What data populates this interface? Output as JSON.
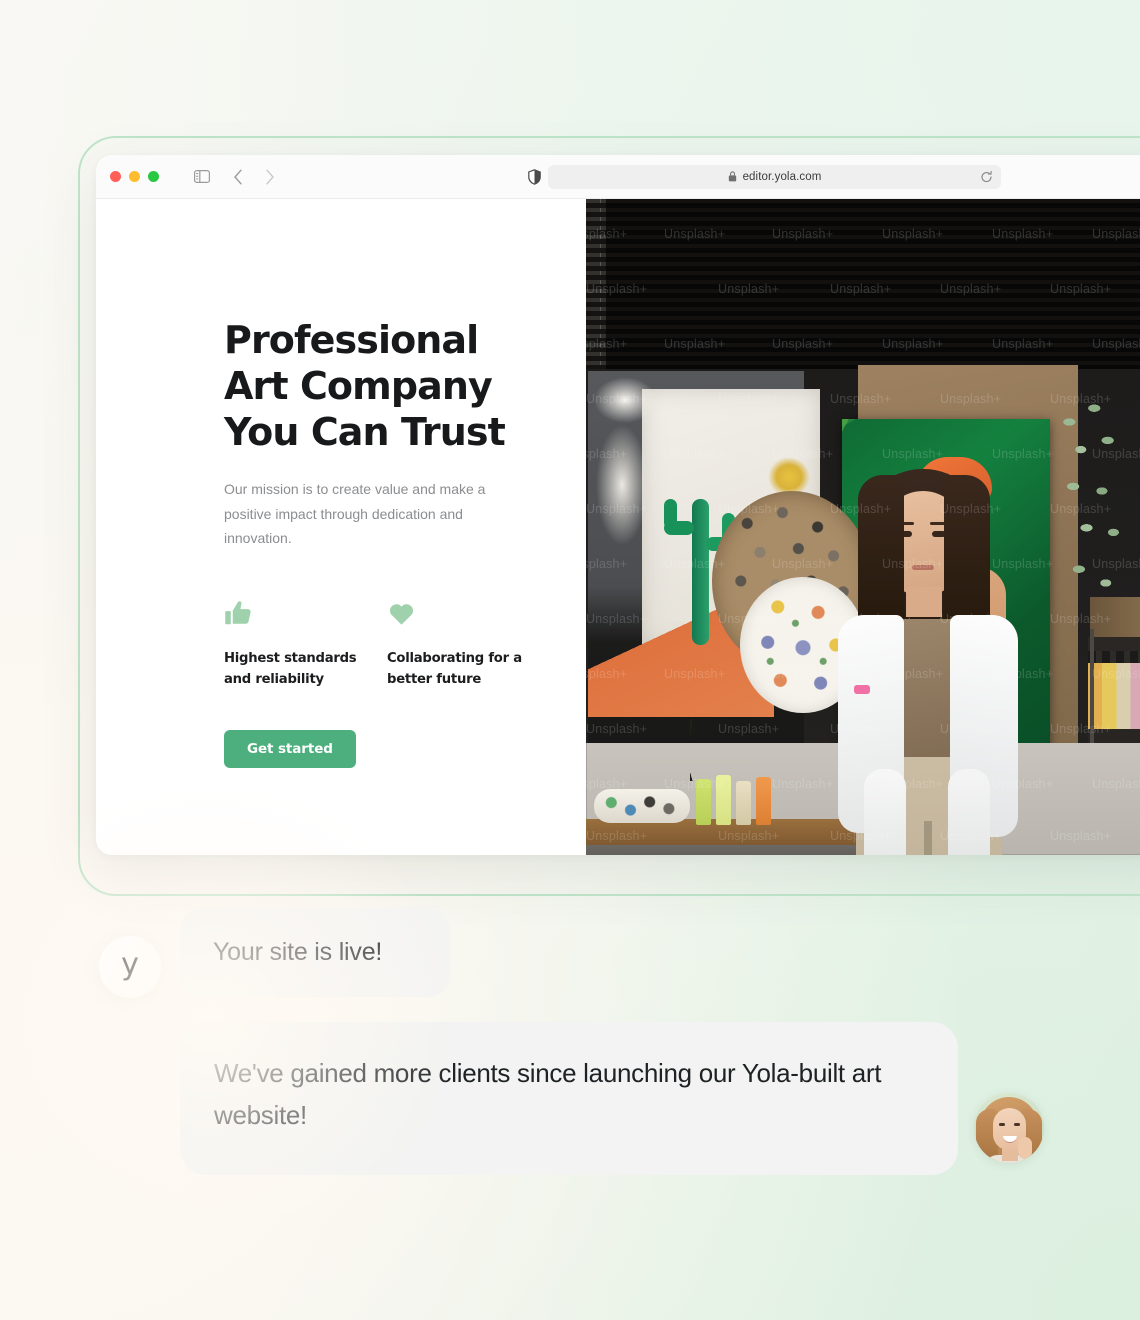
{
  "browser": {
    "window_controls": [
      "close",
      "minimize",
      "zoom"
    ],
    "sidebar_icon": "sidebar-toggle-icon",
    "back_icon": "chevron-left-icon",
    "forward_icon": "chevron-right-icon",
    "shield_icon": "privacy-shield-icon",
    "lock_icon": "lock-icon",
    "reload_icon": "reload-icon",
    "url": "editor.yola.com"
  },
  "hero": {
    "heading": "Professional Art Company You Can Trust",
    "subheading": "Our mission is to create value and make a positive impact through dedication and innovation.",
    "features": [
      {
        "icon": "thumbs-up-icon",
        "label": "Highest standards and reliability"
      },
      {
        "icon": "heart-icon",
        "label": "Collaborating for a better future"
      }
    ],
    "cta_label": "Get started",
    "photo_alt": "Woman artist seated in a painting studio with canvases and paint bottles",
    "photo_watermark": "Unsplash+"
  },
  "chat": {
    "brand_mark": "y",
    "messages": [
      {
        "from": "yola",
        "text": "Your site is live!"
      },
      {
        "from": "client",
        "text": "We've gained more clients since launching our Yola-built art website!"
      }
    ]
  },
  "colors": {
    "accent_green": "#4caf7d",
    "icon_green": "#9ed1ac",
    "frame_green": "#bfe5c9",
    "heading_dark": "#18191b",
    "body_gray": "#8b8d90",
    "bubble_gray": "#f3f4f3"
  }
}
